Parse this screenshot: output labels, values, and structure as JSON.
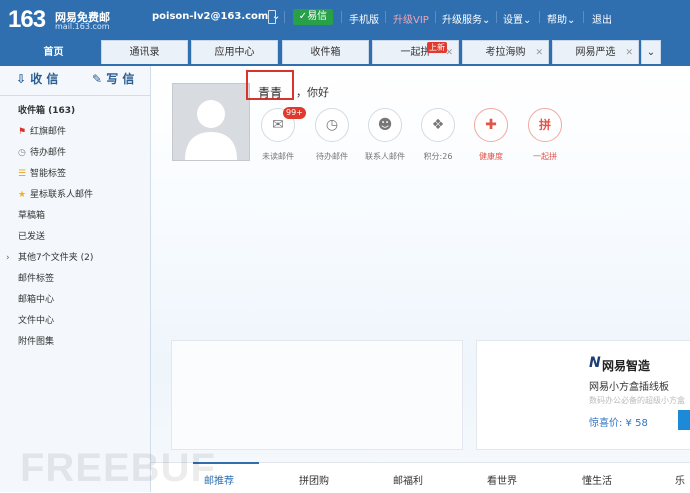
{
  "header": {
    "logo_number": "163",
    "logo_name": "网易免费邮",
    "logo_domain": "mail.163.com",
    "account": "poison-lv2@163.com",
    "yixin": "易信",
    "mobile": "手机版",
    "vip": "升级VIP",
    "upgrade_service": "升级服务",
    "settings": "设置",
    "help": "帮助",
    "logout": "退出"
  },
  "tabs": [
    {
      "label": "首页"
    },
    {
      "label": "通讯录"
    },
    {
      "label": "应用中心"
    },
    {
      "label": "收件箱"
    },
    {
      "label": "一起拼"
    },
    {
      "label": "考拉海购"
    },
    {
      "label": "网易严选"
    }
  ],
  "tab_badge": "上新",
  "sidebar": {
    "receive": "收 信",
    "compose": "写 信",
    "items": [
      {
        "label": "收件箱 (163)"
      },
      {
        "label": "红旗邮件"
      },
      {
        "label": "待办邮件"
      },
      {
        "label": "智能标签"
      },
      {
        "label": "星标联系人邮件"
      },
      {
        "label": "草稿箱"
      },
      {
        "label": "已发送"
      },
      {
        "label": "其他7个文件夹 (2)"
      },
      {
        "label": "邮件标签"
      },
      {
        "label": "邮箱中心"
      },
      {
        "label": "文件中心"
      },
      {
        "label": "附件图集"
      }
    ]
  },
  "greeting": {
    "name": "青青",
    "suffix": "，你好"
  },
  "quick_icons": [
    {
      "label": "未读邮件",
      "icon": "envelope-icon"
    },
    {
      "label": "待办邮件",
      "icon": "clock-icon"
    },
    {
      "label": "联系人邮件",
      "icon": "contact-star-icon"
    },
    {
      "label": "积分:26",
      "icon": "points-icon"
    },
    {
      "label": "健康度",
      "icon": "health-kit-icon"
    },
    {
      "label": "一起拼",
      "icon": "pin-icon"
    }
  ],
  "unread_badge": "99+",
  "ad": {
    "brand_mark": "N",
    "brand": "网易智造",
    "title": "网易小方盒插线板",
    "subtitle": "数码办公必备的超级小方盒",
    "price": "惊喜价: ¥ 58"
  },
  "bottom_nav": [
    {
      "label": "邮推荐"
    },
    {
      "label": "拼团购"
    },
    {
      "label": "邮福利"
    },
    {
      "label": "看世界"
    },
    {
      "label": "懂生活"
    },
    {
      "label": "乐"
    }
  ],
  "watermark": "FREEBUF",
  "colors": {
    "header": "#2f6fb0",
    "accent_red": "#e03a2f",
    "yixin_green": "#27a048"
  }
}
